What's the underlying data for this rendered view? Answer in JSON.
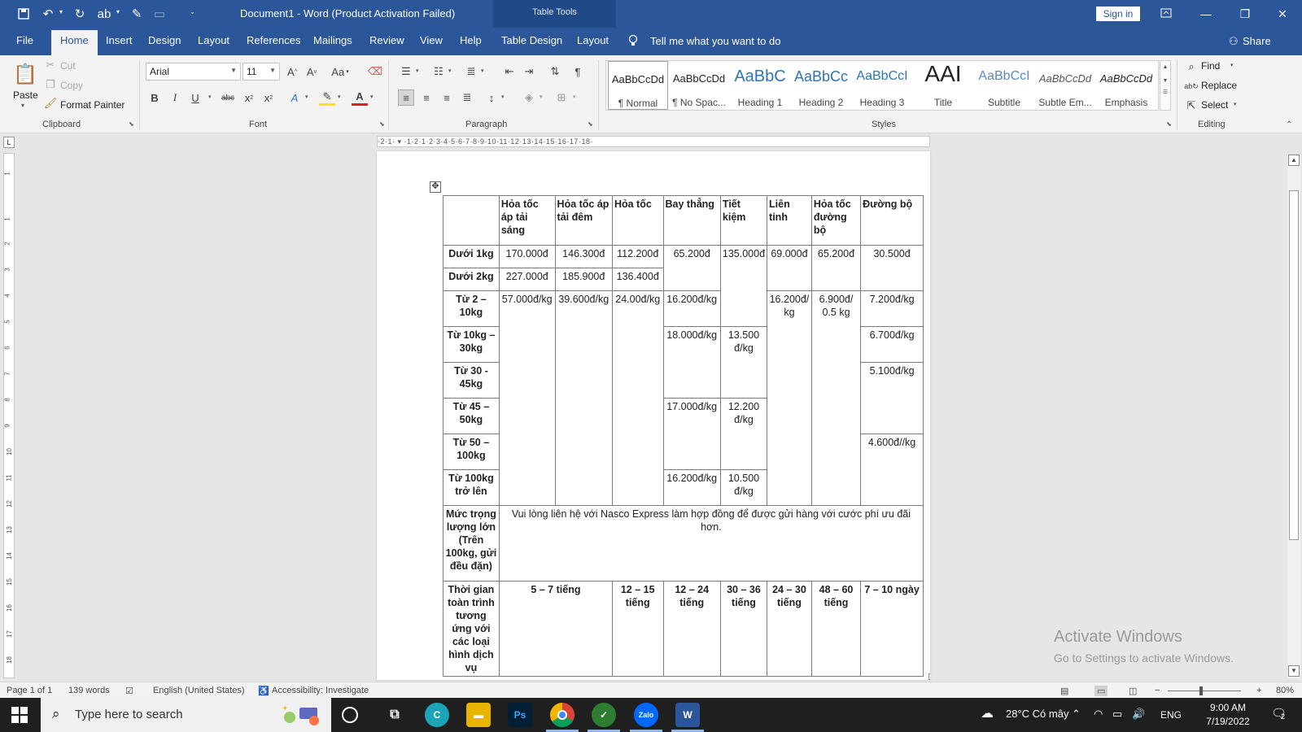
{
  "titlebar": {
    "title": "Document1 - Word (Product Activation Failed)",
    "table_tools": "Table Tools",
    "signin": "Sign in"
  },
  "tabs": [
    "File",
    "Home",
    "Insert",
    "Design",
    "Layout",
    "References",
    "Mailings",
    "Review",
    "View",
    "Help",
    "Table Design",
    "Layout"
  ],
  "active_tab": "Home",
  "tellme": "Tell me what you want to do",
  "share": "Share",
  "ribbon": {
    "clipboard": {
      "paste": "Paste",
      "cut": "Cut",
      "copy": "Copy",
      "format_painter": "Format Painter",
      "label": "Clipboard"
    },
    "font": {
      "name": "Arial",
      "size": "11",
      "label": "Font",
      "case_btn": "Aa"
    },
    "paragraph": {
      "label": "Paragraph"
    },
    "styles": {
      "label": "Styles",
      "items": [
        {
          "preview": "AaBbCcDd",
          "label": "¶ Normal"
        },
        {
          "preview": "AaBbCcDd",
          "label": "¶ No Spac..."
        },
        {
          "preview": "AaBbC",
          "label": "Heading 1"
        },
        {
          "preview": "AaBbCc",
          "label": "Heading 2"
        },
        {
          "preview": "AaBbCcI",
          "label": "Heading 3"
        },
        {
          "preview": "AAI",
          "label": "Title"
        },
        {
          "preview": "AaBbCcI",
          "label": "Subtitle"
        },
        {
          "preview": "AaBbCcDd",
          "label": "Subtle Em..."
        },
        {
          "preview": "AaBbCcDd",
          "label": "Emphasis"
        }
      ]
    },
    "editing": {
      "find": "Find",
      "replace": "Replace",
      "select": "Select",
      "label": "Editing"
    }
  },
  "ruler": {
    "h_text": "·2·1· ▾ ·1·2·1·2·3·4·5·6·7·8·9·10·11·12·13·14·15·16·17·18·",
    "v_ticks": [
      "1",
      "1",
      "2",
      "3",
      "4",
      "5",
      "6",
      "7",
      "8",
      "9",
      "10",
      "11",
      "12",
      "13",
      "14",
      "15",
      "16",
      "17",
      "18"
    ]
  },
  "table": {
    "headers": [
      "",
      "Hỏa tốc áp tải sáng",
      "Hỏa tốc áp tải đêm",
      "Hỏa tốc",
      "Bay thẳng",
      "Tiết kiệm",
      "Liên tỉnh",
      "Hỏa tốc đường bộ",
      "Đường bộ"
    ],
    "row_labels": [
      "Dưới 1kg",
      "Dưới 2kg",
      "Từ 2 – 10kg",
      "Từ 10kg – 30kg",
      "Từ 30 - 45kg",
      "Từ 45 – 50kg",
      "Từ 50 – 100kg",
      "Từ 100kg trở lên"
    ],
    "r1": [
      "170.000đ",
      "146.300đ",
      "112.200đ",
      "65.200đ",
      "135.000đ",
      "69.000đ",
      "65.200đ",
      "30.500đ"
    ],
    "r2": [
      "227.000đ",
      "185.900đ",
      "136.400đ"
    ],
    "r3": [
      "57.000đ/kg",
      "39.600đ/kg",
      "24.00đ/kg",
      "16.200đ/kg",
      "16.200đ/ kg",
      "6.900đ/ 0.5 kg",
      "7.200đ/kg"
    ],
    "r4": [
      "18.000đ/kg",
      "13.500 đ/kg",
      "6.700đ/kg"
    ],
    "r5": [
      "5.100đ/kg"
    ],
    "r6": [
      "17.000đ/kg",
      "12.200 đ/kg"
    ],
    "r7": [
      "4.600đ//kg"
    ],
    "r8": [
      "16.200đ/kg",
      "10.500 đ/kg"
    ],
    "heavy_label": "Mức trọng lượng lớn (Trên 100kg, gửi đều đặn)",
    "heavy_text": "Vui lòng liên hệ với Nasco Express làm hợp đồng để được gửi hàng với cước phí ưu đãi hơn.",
    "time_label": "Thời gian toàn trình tương ứng với các loại hình dịch vụ",
    "times": [
      "5 – 7 tiếng",
      "12 – 15 tiếng",
      "12 – 24 tiếng",
      "30 – 36 tiếng",
      "24 – 30 tiếng",
      "48 – 60 tiếng",
      "7 – 10 ngày"
    ]
  },
  "activate": {
    "line1": "Activate Windows",
    "line2": "Go to Settings to activate Windows."
  },
  "status": {
    "page": "Page 1 of 1",
    "words": "139 words",
    "language": "English (United States)",
    "accessibility": "Accessibility: Investigate",
    "zoom": "80%"
  },
  "taskbar": {
    "search_placeholder": "Type here to search",
    "weather": "28°C Có mây",
    "lang": "ENG",
    "time": "9:00 AM",
    "date": "7/19/2022",
    "notifications": "2",
    "apps": [
      "cortana",
      "task-view",
      "clipchamp",
      "file-explorer",
      "photoshop",
      "chrome",
      "coccoc",
      "zalo",
      "word"
    ]
  },
  "colors": {
    "word_blue": "#2b579a",
    "taskbar": "#1f1f1f",
    "ribbon_bg": "#f3f3f3"
  }
}
